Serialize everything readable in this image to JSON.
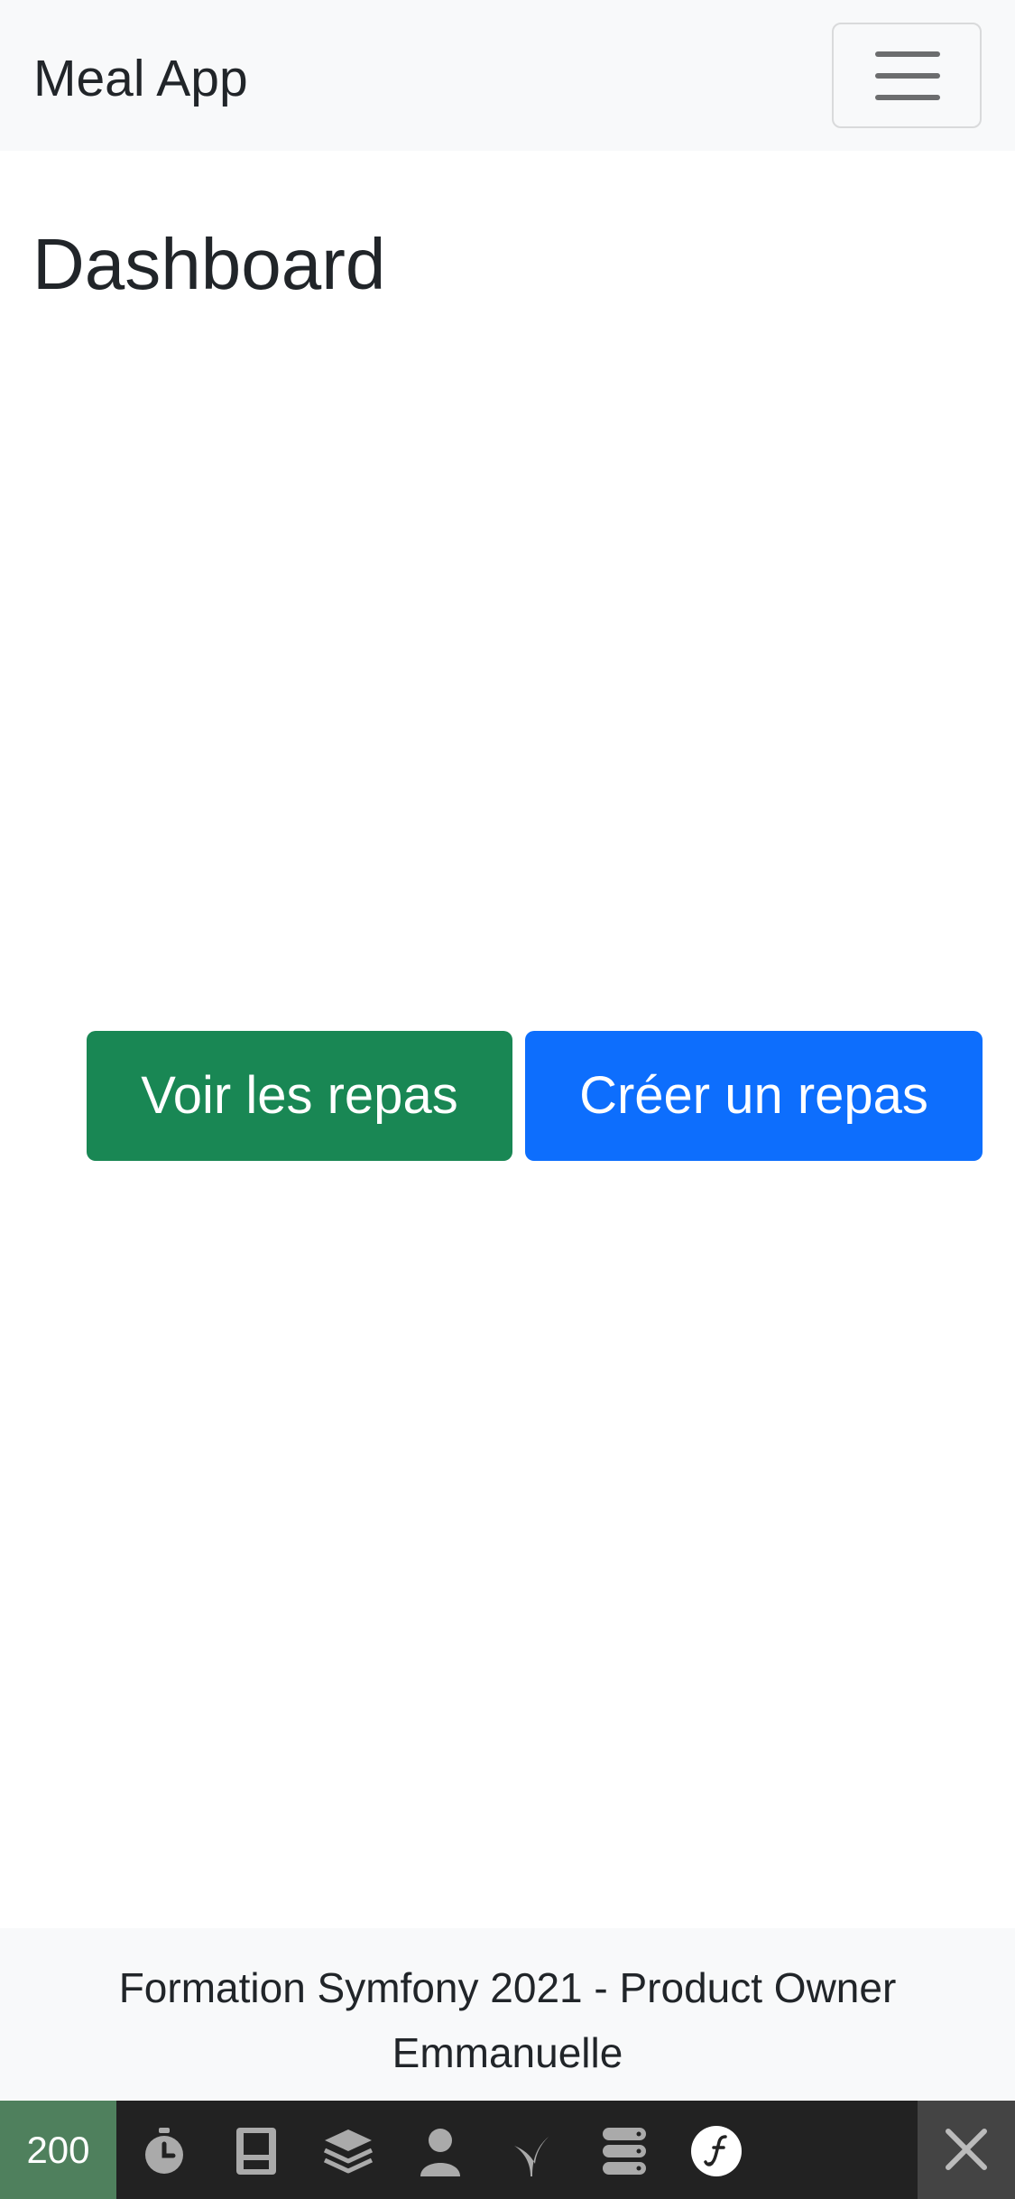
{
  "navbar": {
    "brand": "Meal App",
    "toggler_icon": "hamburger-menu-icon"
  },
  "main": {
    "title": "Dashboard",
    "buttons": {
      "view_meals": "Voir les repas",
      "create_meal": "Créer un repas"
    }
  },
  "footer": {
    "line1": "Formation Symfony 2021 - Product Owner",
    "line2": "Emmanuelle"
  },
  "debug_toolbar": {
    "status_code": "200",
    "icons": [
      "timer-icon",
      "memory-icon",
      "layers-icon",
      "user-icon",
      "twig-icon",
      "database-icon",
      "symfony-logo-icon"
    ],
    "close_icon": "close-icon"
  },
  "colors": {
    "navbar_bg": "#f8f9fa",
    "success": "#198754",
    "primary": "#0d6efd",
    "toolbar_bg": "#222222",
    "status_ok": "#4f805d"
  }
}
